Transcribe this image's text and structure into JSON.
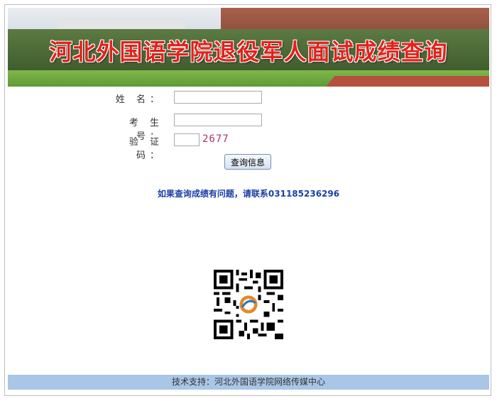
{
  "banner": {
    "title": "河北外国语学院退役军人面试成绩查询"
  },
  "form": {
    "name_label": "姓  名：",
    "exam_no_label": "考 生 号：",
    "captcha_label": "验 证 码：",
    "name_value": "",
    "exam_no_value": "",
    "captcha_value": "",
    "captcha_code": "2677",
    "submit_label": "查询信息"
  },
  "notice": "如果查询成绩有问题，请联系031185236296",
  "qr": {
    "icon": "qr-code-icon"
  },
  "footer": "技术支持：河北外国语学院网络传媒中心",
  "colors": {
    "banner_text": "#e0231b",
    "notice": "#1b3fa8",
    "footer_bg": "#a9c6e6"
  }
}
